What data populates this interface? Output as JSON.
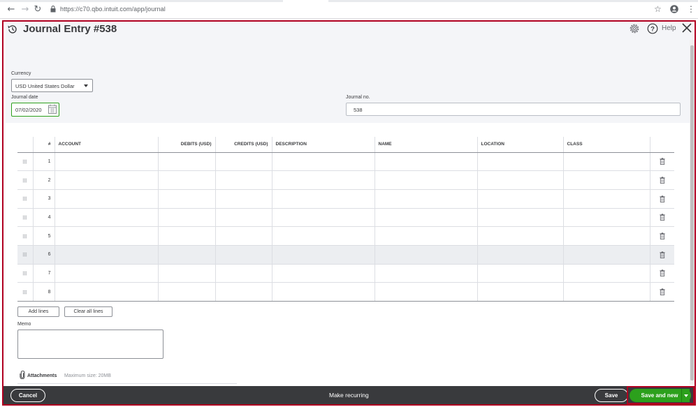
{
  "browser": {
    "url": "https://c70.qbo.intuit.com/app/journal"
  },
  "header": {
    "title": "Journal Entry #538",
    "help_label": "Help"
  },
  "form": {
    "currency_label": "Currency",
    "currency_value": "USD United States Dollar",
    "journal_date_label": "Journal date",
    "journal_date_value": "07/02/2020",
    "journal_no_label": "Journal no.",
    "journal_no_value": "538"
  },
  "table": {
    "columns": [
      "#",
      "ACCOUNT",
      "DEBITS (USD)",
      "CREDITS (USD)",
      "DESCRIPTION",
      "NAME",
      "LOCATION",
      "CLASS"
    ],
    "rows": [
      "1",
      "2",
      "3",
      "4",
      "5",
      "6",
      "7",
      "8"
    ],
    "highlighted_row": "6"
  },
  "actions": {
    "add_lines": "Add lines",
    "clear_all_lines": "Clear all lines"
  },
  "memo": {
    "label": "Memo"
  },
  "attachments": {
    "label": "Attachments",
    "note": "Maximum size: 20MB"
  },
  "footer": {
    "cancel": "Cancel",
    "make_recurring": "Make recurring",
    "save": "Save",
    "save_and_new": "Save and new"
  },
  "colors": {
    "accent_green": "#2ca01c",
    "footer_bg": "#393a3d",
    "header_band": "#f4f5f8",
    "highlight_border": "#b00020"
  }
}
